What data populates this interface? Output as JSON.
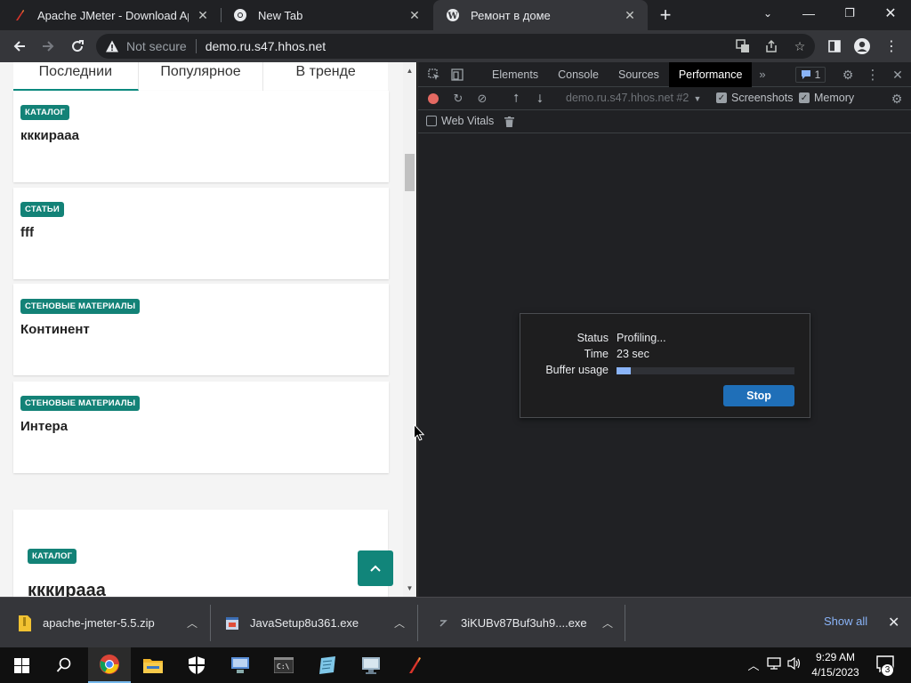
{
  "browser": {
    "tabs": [
      {
        "title": "Apache JMeter - Download Apac"
      },
      {
        "title": "New Tab"
      },
      {
        "title": "Ремонт в доме"
      }
    ],
    "security_label": "Not secure",
    "url": "demo.ru.s47.hhos.net"
  },
  "page": {
    "tabs": [
      {
        "label": "Последнии"
      },
      {
        "label": "Популярное"
      },
      {
        "label": "В тренде"
      }
    ],
    "cards": [
      {
        "badge": "КАТАЛОГ",
        "title": "кккираaa"
      },
      {
        "badge": "СТАТЬИ",
        "title": "fff"
      },
      {
        "badge": "СТЕНОВЫЕ МАТЕРИАЛЫ",
        "title": "Континент"
      },
      {
        "badge": "СТЕНОВЫЕ МАТЕРИАЛЫ",
        "title": "Интера"
      },
      {
        "badge": "КАТАЛОГ",
        "title": "кккираaa"
      }
    ],
    "accent_color": "#138277"
  },
  "devtools": {
    "tabs": [
      {
        "label": "Elements"
      },
      {
        "label": "Console"
      },
      {
        "label": "Sources"
      },
      {
        "label": "Performance"
      }
    ],
    "issues_count": "1",
    "target": "demo.ru.s47.hhos.net #2",
    "screenshots_label": "Screenshots",
    "memory_label": "Memory",
    "web_vitals_label": "Web Vitals",
    "profiling": {
      "status_label": "Status",
      "status_value": "Profiling...",
      "time_label": "Time",
      "time_value": "23 sec",
      "buffer_label": "Buffer usage",
      "buffer_fraction": 0.08,
      "stop_label": "Stop"
    }
  },
  "downloads": {
    "items": [
      {
        "name": "apache-jmeter-5.5.zip"
      },
      {
        "name": "JavaSetup8u361.exe"
      },
      {
        "name": "3iKUBv87Buf3uh9....exe"
      }
    ],
    "show_all_label": "Show all"
  },
  "taskbar": {
    "time": "9:29 AM",
    "date": "4/15/2023",
    "notification_count": "3"
  }
}
